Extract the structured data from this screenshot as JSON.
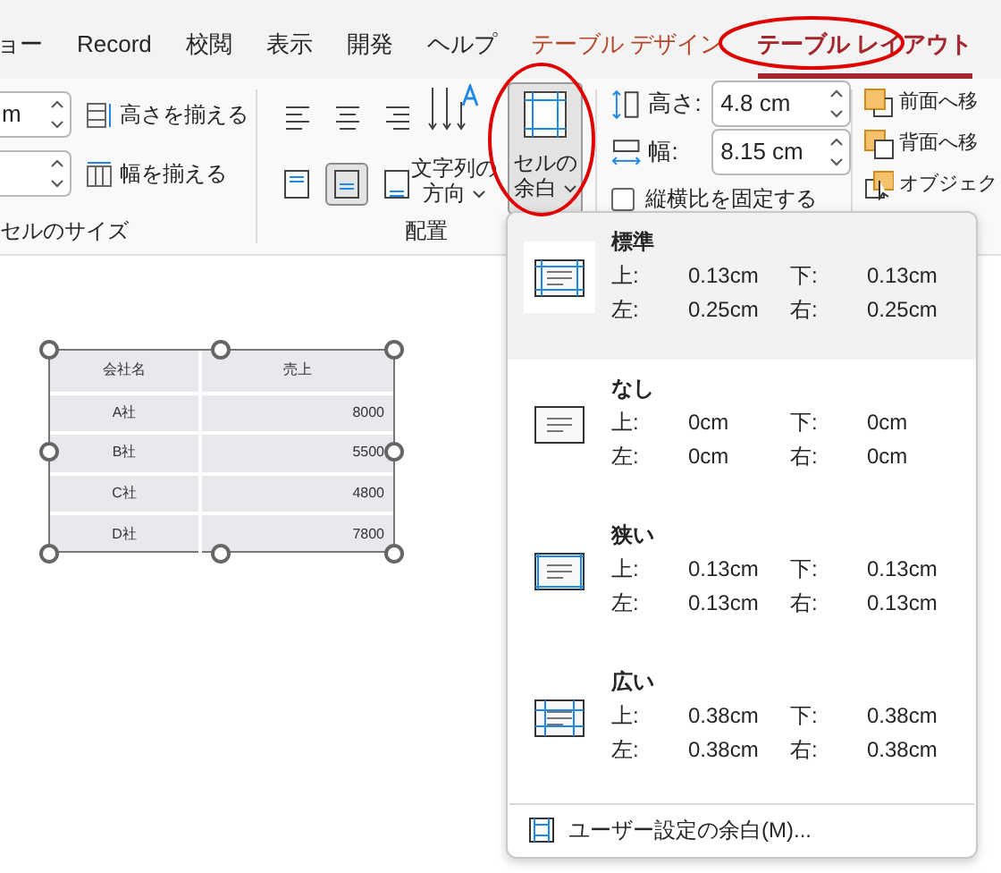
{
  "tabs": [
    {
      "label": "ョー",
      "selected": false,
      "kind": "normal"
    },
    {
      "label": "Record",
      "selected": false,
      "kind": "normal"
    },
    {
      "label": "校閲",
      "selected": false,
      "kind": "normal"
    },
    {
      "label": "表示",
      "selected": false,
      "kind": "normal"
    },
    {
      "label": "開発",
      "selected": false,
      "kind": "normal"
    },
    {
      "label": "ヘルプ",
      "selected": false,
      "kind": "normal"
    },
    {
      "label": "テーブル デザイン",
      "selected": false,
      "kind": "context"
    },
    {
      "label": "テーブル レイアウト",
      "selected": true,
      "kind": "context"
    }
  ],
  "cell_size": {
    "row_height_field": {
      "value": "m"
    },
    "distribute_rows": "高さを揃える",
    "distribute_columns": "幅を揃える",
    "label": "セルのサイズ"
  },
  "alignment": {
    "buttons": [
      {
        "kind": "left",
        "selected": false
      },
      {
        "kind": "center",
        "selected": false
      },
      {
        "kind": "right",
        "selected": false
      },
      {
        "kind": "top",
        "selected": false
      },
      {
        "kind": "middle",
        "selected": true
      },
      {
        "kind": "bottom",
        "selected": false
      }
    ],
    "text_direction": {
      "lines": [
        "文字列の",
        "方向"
      ]
    },
    "cell_margins": {
      "lines": [
        "セルの",
        "余白"
      ],
      "selected": true
    },
    "label": "配置"
  },
  "table_size": {
    "height": {
      "label": "高さ:",
      "value": "4.8 cm"
    },
    "width": {
      "label": "幅:",
      "value": "8.15 cm"
    },
    "lock_aspect": {
      "label": "縦横比を固定する",
      "checked": false
    }
  },
  "arrange": {
    "items": [
      "前面へ移",
      "背面へ移",
      "オブジェク"
    ]
  },
  "table": {
    "columns": [
      "会社名",
      "売上"
    ],
    "rows": [
      [
        "A社",
        "8000"
      ],
      [
        "B社",
        "5500"
      ],
      [
        "C社",
        "4800"
      ],
      [
        "D社",
        "7800"
      ]
    ]
  },
  "margin_menu": {
    "presets": [
      {
        "name": "標準",
        "kind": "normal",
        "selected": true,
        "top_label": "上:",
        "top": "0.13cm",
        "bottom_label": "下:",
        "bottom": "0.13cm",
        "left_label": "左:",
        "left": "0.25cm",
        "right_label": "右:",
        "right": "0.25cm"
      },
      {
        "name": "なし",
        "kind": "none",
        "selected": false,
        "top_label": "上:",
        "top": "0cm",
        "bottom_label": "下:",
        "bottom": "0cm",
        "left_label": "左:",
        "left": "0cm",
        "right_label": "右:",
        "right": "0cm"
      },
      {
        "name": "狭い",
        "kind": "narrow",
        "selected": false,
        "top_label": "上:",
        "top": "0.13cm",
        "bottom_label": "下:",
        "bottom": "0.13cm",
        "left_label": "左:",
        "left": "0.13cm",
        "right_label": "右:",
        "right": "0.13cm"
      },
      {
        "name": "広い",
        "kind": "wide",
        "selected": false,
        "top_label": "上:",
        "top": "0.38cm",
        "bottom_label": "下:",
        "bottom": "0.38cm",
        "left_label": "左:",
        "left": "0.38cm",
        "right_label": "右:",
        "right": "0.38cm"
      }
    ],
    "custom": {
      "label": "ユーザー設定の余白(M)..."
    }
  }
}
